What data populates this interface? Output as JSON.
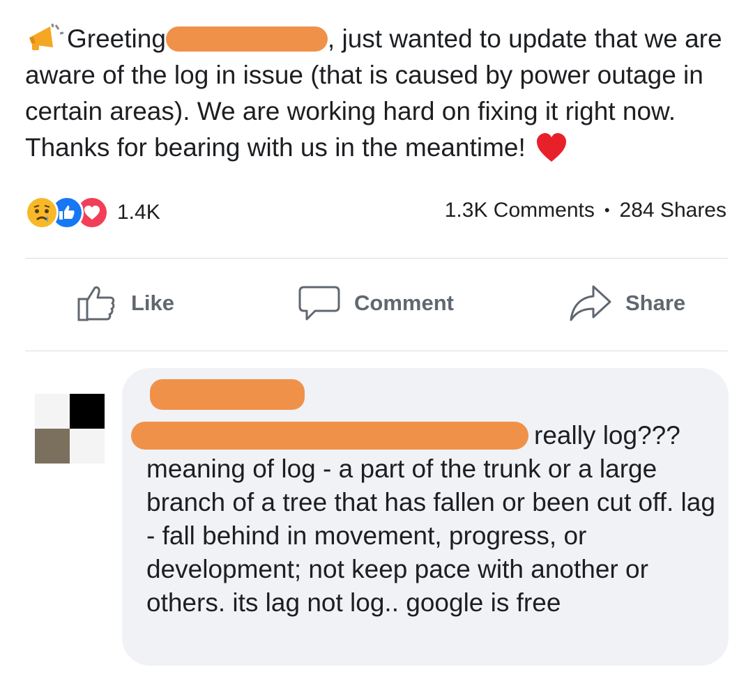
{
  "post": {
    "text_before": "Greeting",
    "text_after": ", just wanted to update that we are aware of the log in issue (that is caused by power outage in certain areas). We are working hard on fixing it right now. Thanks for bearing with us in the meantime!",
    "megaphone_icon": "megaphone-icon",
    "heart_icon": "red-heart-icon"
  },
  "reactions": {
    "icons": [
      "sad-reaction-icon",
      "like-reaction-icon",
      "love-reaction-icon"
    ],
    "count": "1.4K"
  },
  "stats": {
    "comments": "1.3K Comments",
    "shares": "284 Shares",
    "separator": "•"
  },
  "actions": {
    "like": "Like",
    "comment": "Comment",
    "share": "Share"
  },
  "comment": {
    "text_visible_first_line": "really",
    "text_body": "log??? meaning of log - a part of the trunk or a large branch of a tree that has fallen or been cut off. lag - fall behind in movement, progress, or development; not keep pace with another or others. its lag not log.. google is free"
  },
  "colors": {
    "redaction": "#f0914a",
    "bubble": "#f0f2f5",
    "action_text": "#606770",
    "like_blue": "#1877f2",
    "love_red": "#f33e58",
    "sad_yellow": "#f7b928"
  }
}
